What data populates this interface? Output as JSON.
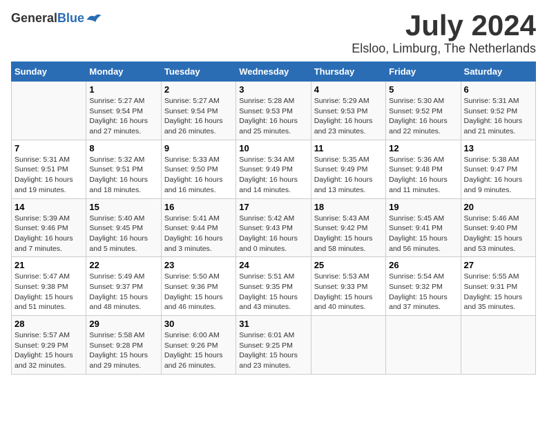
{
  "header": {
    "logo_general": "General",
    "logo_blue": "Blue",
    "month": "July 2024",
    "location": "Elsloo, Limburg, The Netherlands"
  },
  "weekdays": [
    "Sunday",
    "Monday",
    "Tuesday",
    "Wednesday",
    "Thursday",
    "Friday",
    "Saturday"
  ],
  "weeks": [
    [
      {
        "day": "",
        "info": ""
      },
      {
        "day": "1",
        "info": "Sunrise: 5:27 AM\nSunset: 9:54 PM\nDaylight: 16 hours\nand 27 minutes."
      },
      {
        "day": "2",
        "info": "Sunrise: 5:27 AM\nSunset: 9:54 PM\nDaylight: 16 hours\nand 26 minutes."
      },
      {
        "day": "3",
        "info": "Sunrise: 5:28 AM\nSunset: 9:53 PM\nDaylight: 16 hours\nand 25 minutes."
      },
      {
        "day": "4",
        "info": "Sunrise: 5:29 AM\nSunset: 9:53 PM\nDaylight: 16 hours\nand 23 minutes."
      },
      {
        "day": "5",
        "info": "Sunrise: 5:30 AM\nSunset: 9:52 PM\nDaylight: 16 hours\nand 22 minutes."
      },
      {
        "day": "6",
        "info": "Sunrise: 5:31 AM\nSunset: 9:52 PM\nDaylight: 16 hours\nand 21 minutes."
      }
    ],
    [
      {
        "day": "7",
        "info": "Sunrise: 5:31 AM\nSunset: 9:51 PM\nDaylight: 16 hours\nand 19 minutes."
      },
      {
        "day": "8",
        "info": "Sunrise: 5:32 AM\nSunset: 9:51 PM\nDaylight: 16 hours\nand 18 minutes."
      },
      {
        "day": "9",
        "info": "Sunrise: 5:33 AM\nSunset: 9:50 PM\nDaylight: 16 hours\nand 16 minutes."
      },
      {
        "day": "10",
        "info": "Sunrise: 5:34 AM\nSunset: 9:49 PM\nDaylight: 16 hours\nand 14 minutes."
      },
      {
        "day": "11",
        "info": "Sunrise: 5:35 AM\nSunset: 9:49 PM\nDaylight: 16 hours\nand 13 minutes."
      },
      {
        "day": "12",
        "info": "Sunrise: 5:36 AM\nSunset: 9:48 PM\nDaylight: 16 hours\nand 11 minutes."
      },
      {
        "day": "13",
        "info": "Sunrise: 5:38 AM\nSunset: 9:47 PM\nDaylight: 16 hours\nand 9 minutes."
      }
    ],
    [
      {
        "day": "14",
        "info": "Sunrise: 5:39 AM\nSunset: 9:46 PM\nDaylight: 16 hours\nand 7 minutes."
      },
      {
        "day": "15",
        "info": "Sunrise: 5:40 AM\nSunset: 9:45 PM\nDaylight: 16 hours\nand 5 minutes."
      },
      {
        "day": "16",
        "info": "Sunrise: 5:41 AM\nSunset: 9:44 PM\nDaylight: 16 hours\nand 3 minutes."
      },
      {
        "day": "17",
        "info": "Sunrise: 5:42 AM\nSunset: 9:43 PM\nDaylight: 16 hours\nand 0 minutes."
      },
      {
        "day": "18",
        "info": "Sunrise: 5:43 AM\nSunset: 9:42 PM\nDaylight: 15 hours\nand 58 minutes."
      },
      {
        "day": "19",
        "info": "Sunrise: 5:45 AM\nSunset: 9:41 PM\nDaylight: 15 hours\nand 56 minutes."
      },
      {
        "day": "20",
        "info": "Sunrise: 5:46 AM\nSunset: 9:40 PM\nDaylight: 15 hours\nand 53 minutes."
      }
    ],
    [
      {
        "day": "21",
        "info": "Sunrise: 5:47 AM\nSunset: 9:38 PM\nDaylight: 15 hours\nand 51 minutes."
      },
      {
        "day": "22",
        "info": "Sunrise: 5:49 AM\nSunset: 9:37 PM\nDaylight: 15 hours\nand 48 minutes."
      },
      {
        "day": "23",
        "info": "Sunrise: 5:50 AM\nSunset: 9:36 PM\nDaylight: 15 hours\nand 46 minutes."
      },
      {
        "day": "24",
        "info": "Sunrise: 5:51 AM\nSunset: 9:35 PM\nDaylight: 15 hours\nand 43 minutes."
      },
      {
        "day": "25",
        "info": "Sunrise: 5:53 AM\nSunset: 9:33 PM\nDaylight: 15 hours\nand 40 minutes."
      },
      {
        "day": "26",
        "info": "Sunrise: 5:54 AM\nSunset: 9:32 PM\nDaylight: 15 hours\nand 37 minutes."
      },
      {
        "day": "27",
        "info": "Sunrise: 5:55 AM\nSunset: 9:31 PM\nDaylight: 15 hours\nand 35 minutes."
      }
    ],
    [
      {
        "day": "28",
        "info": "Sunrise: 5:57 AM\nSunset: 9:29 PM\nDaylight: 15 hours\nand 32 minutes."
      },
      {
        "day": "29",
        "info": "Sunrise: 5:58 AM\nSunset: 9:28 PM\nDaylight: 15 hours\nand 29 minutes."
      },
      {
        "day": "30",
        "info": "Sunrise: 6:00 AM\nSunset: 9:26 PM\nDaylight: 15 hours\nand 26 minutes."
      },
      {
        "day": "31",
        "info": "Sunrise: 6:01 AM\nSunset: 9:25 PM\nDaylight: 15 hours\nand 23 minutes."
      },
      {
        "day": "",
        "info": ""
      },
      {
        "day": "",
        "info": ""
      },
      {
        "day": "",
        "info": ""
      }
    ]
  ]
}
